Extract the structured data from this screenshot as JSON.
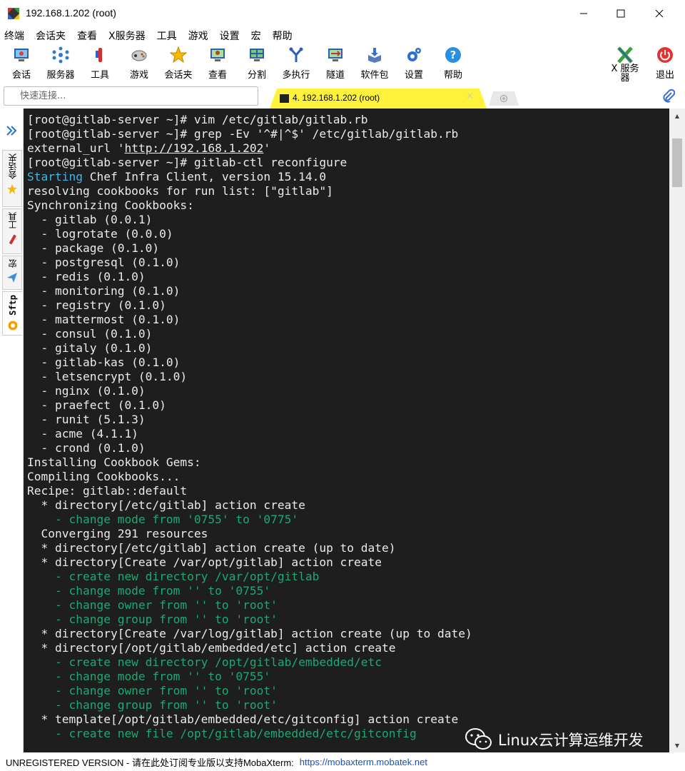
{
  "window": {
    "title": "192.168.1.202 (root)"
  },
  "menu": [
    "终端",
    "会话夹",
    "查看",
    "X服务器",
    "工具",
    "游戏",
    "设置",
    "宏",
    "帮助"
  ],
  "toolbar": {
    "session": "会话",
    "servers": "服务器",
    "tools": "工具",
    "games": "游戏",
    "sessions_folder": "会话夹",
    "view": "查看",
    "split": "分割",
    "multiexec": "多执行",
    "tunneling": "隧道",
    "packages": "软件包",
    "settings": "设置",
    "help": "帮助",
    "xserver": "X 服务\n器",
    "exit": "退出"
  },
  "quick_connect": {
    "placeholder": "快速连接..."
  },
  "tabs": {
    "active_label": "4. 192.168.1.202 (root)",
    "close": "×"
  },
  "sidebar": {
    "sessions": "会话夹",
    "tools": "工具",
    "macros": "宏",
    "sftp": "Sftp"
  },
  "terminal": {
    "external_url_prefix": "external_url '",
    "external_url_link": "http://192.168.1.202",
    "external_url_suffix": "'",
    "starting_word": "Starting",
    "starting_rest": " Chef Infra Client, version 15.14.0",
    "lines": [
      {
        "t": "[root@gitlab-server ~]# vim /etc/gitlab/gitlab.rb",
        "c": ""
      },
      {
        "t": "[root@gitlab-server ~]# grep -Ev '^#|^$' /etc/gitlab/gitlab.rb",
        "c": ""
      },
      {
        "t": "",
        "c": "url"
      },
      {
        "t": "[root@gitlab-server ~]# gitlab-ctl reconfigure",
        "c": ""
      },
      {
        "t": "",
        "c": "start"
      },
      {
        "t": "resolving cookbooks for run list: [\"gitlab\"]",
        "c": ""
      },
      {
        "t": "Synchronizing Cookbooks:",
        "c": ""
      },
      {
        "t": "  - gitlab (0.0.1)",
        "c": ""
      },
      {
        "t": "  - logrotate (0.0.0)",
        "c": ""
      },
      {
        "t": "  - package (0.1.0)",
        "c": ""
      },
      {
        "t": "  - postgresql (0.1.0)",
        "c": ""
      },
      {
        "t": "  - redis (0.1.0)",
        "c": ""
      },
      {
        "t": "  - monitoring (0.1.0)",
        "c": ""
      },
      {
        "t": "  - registry (0.1.0)",
        "c": ""
      },
      {
        "t": "  - mattermost (0.1.0)",
        "c": ""
      },
      {
        "t": "  - consul (0.1.0)",
        "c": ""
      },
      {
        "t": "  - gitaly (0.1.0)",
        "c": ""
      },
      {
        "t": "  - gitlab-kas (0.1.0)",
        "c": ""
      },
      {
        "t": "  - letsencrypt (0.1.0)",
        "c": ""
      },
      {
        "t": "  - nginx (0.1.0)",
        "c": ""
      },
      {
        "t": "  - praefect (0.1.0)",
        "c": ""
      },
      {
        "t": "  - runit (5.1.3)",
        "c": ""
      },
      {
        "t": "  - acme (4.1.1)",
        "c": ""
      },
      {
        "t": "  - crond (0.1.0)",
        "c": ""
      },
      {
        "t": "Installing Cookbook Gems:",
        "c": ""
      },
      {
        "t": "Compiling Cookbooks...",
        "c": ""
      },
      {
        "t": "Recipe: gitlab::default",
        "c": ""
      },
      {
        "t": "  * directory[/etc/gitlab] action create",
        "c": ""
      },
      {
        "t": "    - change mode from '0755' to '0775'",
        "c": "green"
      },
      {
        "t": "  Converging 291 resources",
        "c": ""
      },
      {
        "t": "  * directory[/etc/gitlab] action create (up to date)",
        "c": ""
      },
      {
        "t": "  * directory[Create /var/opt/gitlab] action create",
        "c": ""
      },
      {
        "t": "    - create new directory /var/opt/gitlab",
        "c": "green"
      },
      {
        "t": "    - change mode from '' to '0755'",
        "c": "green"
      },
      {
        "t": "    - change owner from '' to 'root'",
        "c": "green"
      },
      {
        "t": "    - change group from '' to 'root'",
        "c": "green"
      },
      {
        "t": "  * directory[Create /var/log/gitlab] action create (up to date)",
        "c": ""
      },
      {
        "t": "  * directory[/opt/gitlab/embedded/etc] action create",
        "c": ""
      },
      {
        "t": "    - create new directory /opt/gitlab/embedded/etc",
        "c": "green"
      },
      {
        "t": "    - change mode from '' to '0755'",
        "c": "green"
      },
      {
        "t": "    - change owner from '' to 'root'",
        "c": "green"
      },
      {
        "t": "    - change group from '' to 'root'",
        "c": "green"
      },
      {
        "t": "  * template[/opt/gitlab/embedded/etc/gitconfig] action create",
        "c": ""
      },
      {
        "t": "    - create new file /opt/gitlab/embedded/etc/gitconfig",
        "c": "green"
      }
    ]
  },
  "watermark": {
    "text": "Linux云计算运维开发"
  },
  "status": {
    "unregistered": "UNREGISTERED VERSION  -  请在此处订阅专业版以支持MobaXterm:",
    "link": "https://mobaxterm.mobatek.net"
  },
  "colors": {
    "terminal_bg": "#1e1e1e",
    "terminal_fg": "#ebebeb",
    "cyan": "#3fb5e8",
    "green": "#1aaa72",
    "active_tab": "#fff23a"
  }
}
